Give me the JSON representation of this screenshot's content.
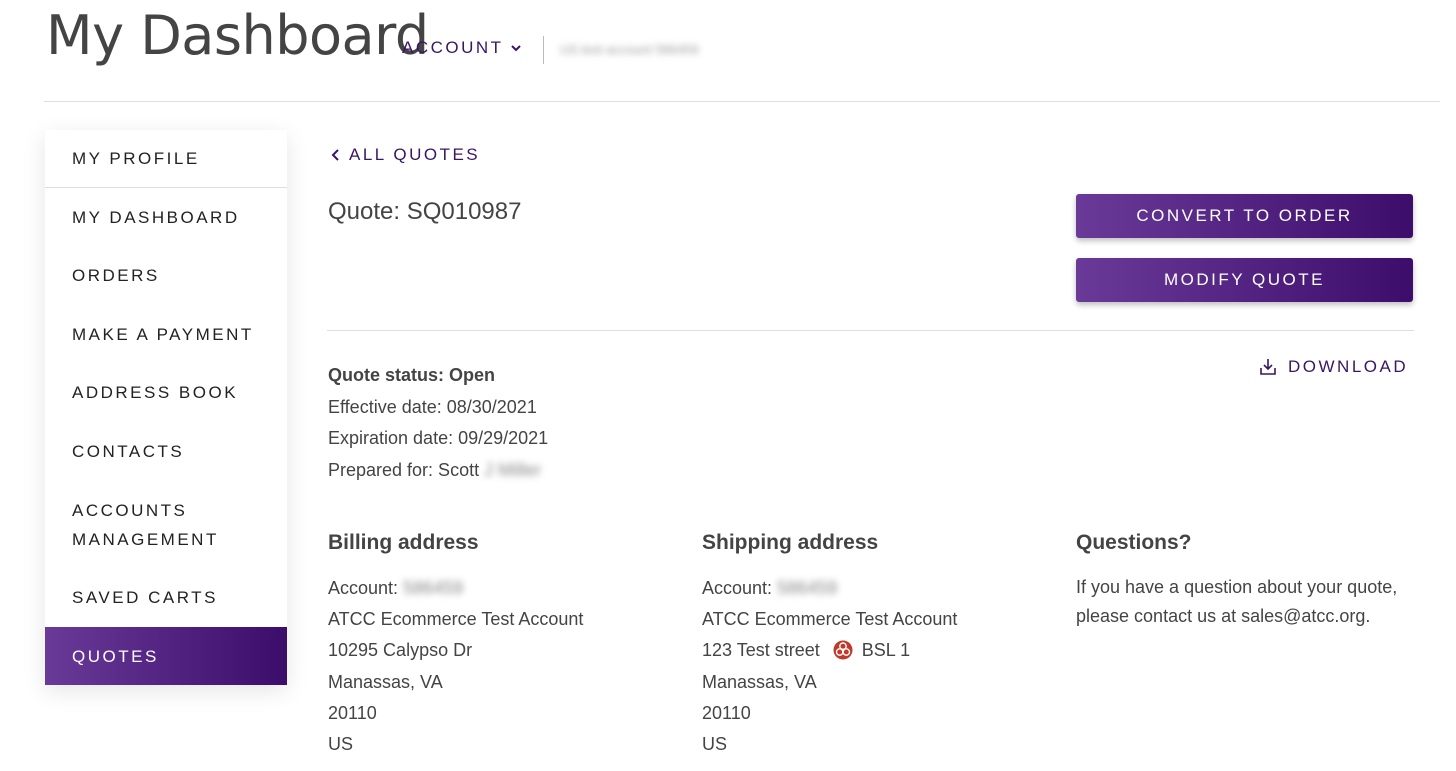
{
  "header": {
    "title": "My Dashboard",
    "account_label": "ACCOUNT",
    "account_id": "US test account 586459"
  },
  "sidebar": {
    "items": [
      {
        "label": "MY PROFILE"
      },
      {
        "label": "MY DASHBOARD"
      },
      {
        "label": "ORDERS"
      },
      {
        "label": "MAKE A PAYMENT"
      },
      {
        "label": "ADDRESS BOOK"
      },
      {
        "label": "CONTACTS"
      },
      {
        "label": "ACCOUNTS MANAGEMENT"
      },
      {
        "label": "SAVED CARTS"
      },
      {
        "label": "QUOTES",
        "active": true
      }
    ]
  },
  "quote": {
    "back_label": "ALL QUOTES",
    "title": "Quote: SQ010987",
    "convert_label": "CONVERT TO ORDER",
    "modify_label": "MODIFY QUOTE",
    "download_label": "DOWNLOAD",
    "status": "Quote status: Open",
    "effective": "Effective date: 08/30/2021",
    "expiration": "Expiration date: 09/29/2021",
    "prepared_prefix": "Prepared for: Scott",
    "prepared_name": "J Miller"
  },
  "billing": {
    "heading": "Billing address",
    "account_prefix": "Account:",
    "account_id": "586459",
    "name": "ATCC Ecommerce Test Account",
    "street": "10295 Calypso Dr",
    "city": "Manassas, VA",
    "zip": "20110",
    "country": "US"
  },
  "shipping": {
    "heading": "Shipping address",
    "account_prefix": "Account:",
    "account_id": "586459",
    "name": "ATCC Ecommerce Test Account",
    "street": "123 Test street",
    "bsl": "BSL 1",
    "city": "Manassas, VA",
    "zip": "20110",
    "country": "US"
  },
  "questions": {
    "heading": "Questions?",
    "text": "If you have a question about your quote, please contact us at sales@atcc.org."
  },
  "colors": {
    "brand_purple": "#3c0d6b",
    "brand_purple_light": "#6a3a98",
    "biohazard": "#c0392b"
  }
}
